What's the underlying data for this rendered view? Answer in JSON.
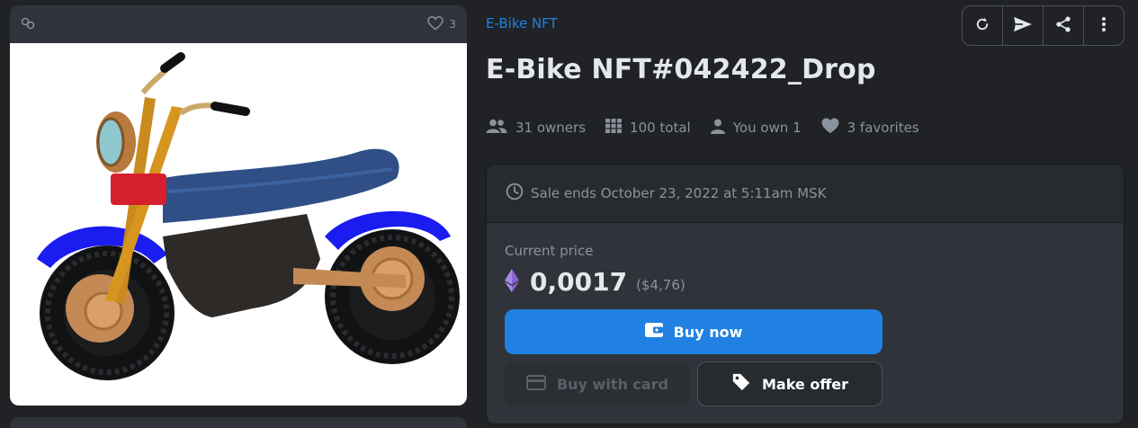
{
  "collection": "E-Bike NFT",
  "title": "E-Bike NFT#042422_Drop",
  "card": {
    "favorites_count": "3",
    "image_alt": "Motorbike 3D model"
  },
  "stats": {
    "owners": "31 owners",
    "total": "100 total",
    "you_own": "You own 1",
    "favorites": "3 favorites"
  },
  "toolbar": {
    "icons": [
      "refresh-icon",
      "send-icon",
      "share-icon",
      "more-icon"
    ]
  },
  "sale": {
    "ends": "Sale ends October 23, 2022 at 5:11am MSK",
    "price_label": "Current price",
    "price": "0,0017",
    "price_usd": "($4,76)"
  },
  "buttons": {
    "buy_now": "Buy now",
    "buy_with_card": "Buy with card",
    "make_offer": "Make offer"
  },
  "colors": {
    "accent": "#2081e2",
    "background": "#202225",
    "panel": "#303339"
  }
}
